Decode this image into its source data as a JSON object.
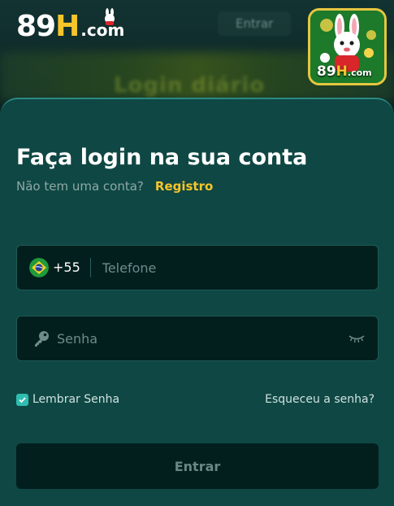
{
  "header": {
    "logo": {
      "num": "89",
      "h": "H",
      "com": ".com"
    },
    "bg_button": "Entrar",
    "bg_banner": "Login diário",
    "app_icon": {
      "num": "89",
      "h": "H",
      "com": ".com"
    }
  },
  "login": {
    "title": "Faça login na sua conta",
    "no_account": "Não tem uma conta?",
    "register_link": "Registro",
    "country_code": "+55",
    "phone_placeholder": "Telefone",
    "password_placeholder": "Senha",
    "remember_label": "Lembrar Senha",
    "remember_checked": true,
    "forgot_link": "Esqueceu a senha?",
    "submit_label": "Entrar"
  },
  "colors": {
    "accent": "#f7c52a",
    "card": "#0f4744",
    "field": "#021f1e",
    "checkbox": "#2fbdb0"
  },
  "icons": [
    "brazil-flag-icon",
    "key-icon",
    "eye-closed-icon",
    "checkmark-icon"
  ]
}
